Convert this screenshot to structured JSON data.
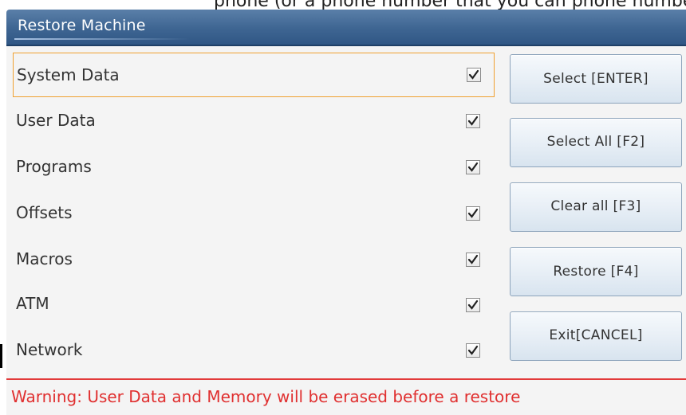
{
  "header": {
    "partial_text": "phone (or a phone number that you can phone number that you can call back a)"
  },
  "dialog": {
    "title": "Restore Machine"
  },
  "list": {
    "items": [
      {
        "label": "System Data",
        "checked": true,
        "selected": true
      },
      {
        "label": "User Data",
        "checked": true,
        "selected": false
      },
      {
        "label": "Programs",
        "checked": true,
        "selected": false
      },
      {
        "label": "Offsets",
        "checked": true,
        "selected": false
      },
      {
        "label": "Macros",
        "checked": true,
        "selected": false
      },
      {
        "label": "ATM",
        "checked": true,
        "selected": false
      },
      {
        "label": "Network",
        "checked": true,
        "selected": false
      }
    ]
  },
  "buttons": {
    "select": "Select [ENTER]",
    "select_all": "Select All [F2]",
    "clear_all": "Clear all [F3]",
    "restore": "Restore [F4]",
    "exit": "Exit[CANCEL]"
  },
  "footer": {
    "warning": "Warning: User Data and Memory will be erased before a restore"
  },
  "colors": {
    "title_bar": "#3f6693",
    "selection_border": "#f0a030",
    "warning": "#e03030"
  }
}
